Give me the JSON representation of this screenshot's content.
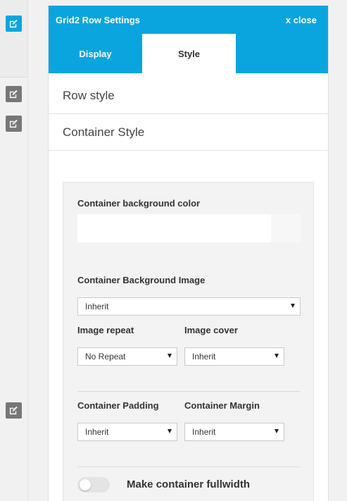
{
  "colors": {
    "accent": "#0aa5df",
    "edit_gray": "#777777"
  },
  "left_rail": {
    "buttons": [
      {
        "icon": "edit-icon",
        "style": "blue"
      },
      {
        "icon": "edit-icon",
        "style": "gray"
      },
      {
        "icon": "edit-icon",
        "style": "gray"
      },
      {
        "icon": "edit-icon",
        "style": "gray"
      }
    ]
  },
  "panel": {
    "title": "Grid2 Row Settings",
    "close_label": "x close",
    "tabs": [
      {
        "label": "Display",
        "active": false
      },
      {
        "label": "Style",
        "active": true
      }
    ],
    "sections": {
      "row_style": "Row style",
      "container_style": "Container Style"
    },
    "container": {
      "bg_color_label": "Container background color",
      "bg_color_value": "",
      "bg_image_label": "Container Background Image",
      "bg_image_value": "Inherit",
      "image_repeat_label": "Image repeat",
      "image_repeat_value": "No Repeat",
      "image_cover_label": "Image cover",
      "image_cover_value": "Inherit",
      "padding_label": "Container Padding",
      "padding_value": "Inherit",
      "margin_label": "Container Margin",
      "margin_value": "Inherit",
      "fullwidth_label": "Make container fullwidth",
      "fullwidth_on": false
    }
  }
}
